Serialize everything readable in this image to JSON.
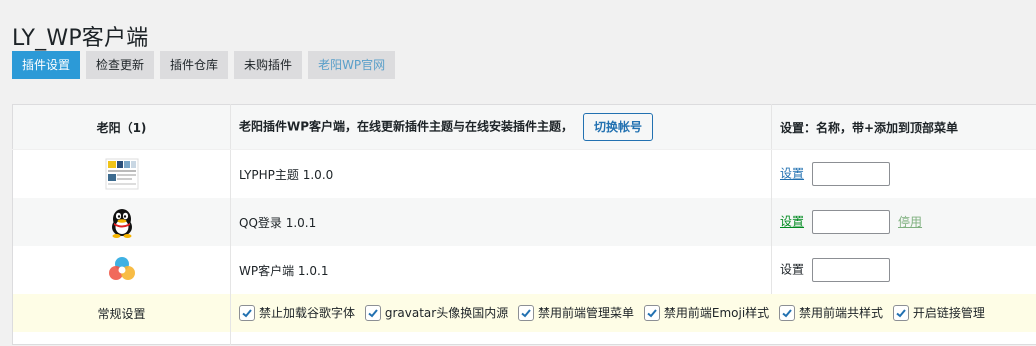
{
  "page": {
    "title": "LY_WP客户端"
  },
  "tabs": [
    {
      "label": "插件设置",
      "active": true
    },
    {
      "label": "检查更新"
    },
    {
      "label": "插件仓库"
    },
    {
      "label": "未购插件"
    },
    {
      "label": "老阳WP官网"
    }
  ],
  "table": {
    "header": {
      "col1": "老阳（1)",
      "col2": "老阳插件WP客户端，在线更新插件主题与在线安装插件主题，",
      "switch_button": "切换帐号",
      "col3": "设置：名称，带+添加到顶部菜单"
    },
    "rows": [
      {
        "icon": "theme-thumbnail-icon",
        "name": "LYPHP主题  1.0.0",
        "setting": "设置",
        "input": ""
      },
      {
        "icon": "qq-penguin-icon",
        "name": "QQ登录  1.0.1",
        "setting": "设置",
        "input": "",
        "disable": "停用"
      },
      {
        "icon": "wp-client-logo-icon",
        "name": "WP客户端  1.0.1",
        "setting": "设置",
        "input": ""
      }
    ],
    "general": {
      "label": "常规设置",
      "options": [
        {
          "label": "禁止加载谷歌字体",
          "checked": true
        },
        {
          "label": "gravatar头像换国内源",
          "checked": true
        },
        {
          "label": "禁用前端管理菜单",
          "checked": true
        },
        {
          "label": "禁用前端Emoji样式",
          "checked": true
        },
        {
          "label": "禁用前端共样式",
          "checked": true
        },
        {
          "label": "开启链接管理",
          "checked": true
        }
      ]
    }
  }
}
